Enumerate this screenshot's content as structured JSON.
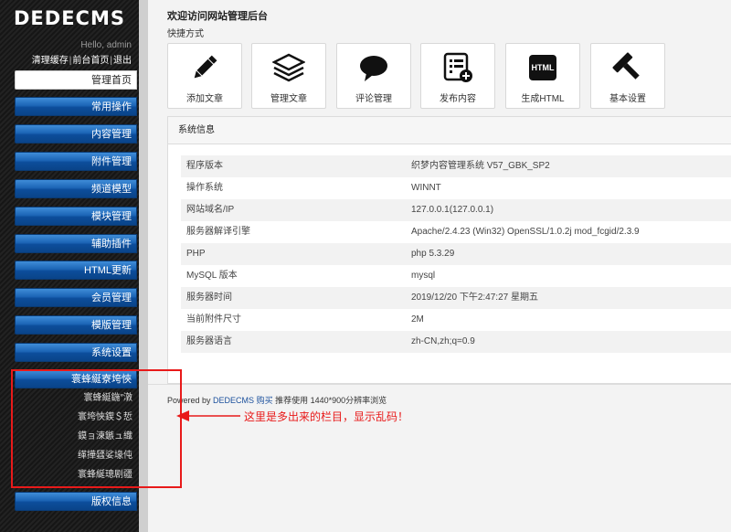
{
  "sidebar": {
    "logo": "DEDECMS",
    "hello": "Hello, admin",
    "links": [
      "清理缓存",
      "前台首页",
      "退出"
    ],
    "menu": [
      {
        "label": "管理首页",
        "active": true
      },
      {
        "label": "常用操作"
      },
      {
        "label": "内容管理"
      },
      {
        "label": "附件管理"
      },
      {
        "label": "频道模型"
      },
      {
        "label": "模块管理"
      },
      {
        "label": "辅助插件"
      },
      {
        "label": "HTML更新"
      },
      {
        "label": "会员管理"
      },
      {
        "label": "模版管理"
      },
      {
        "label": "系统设置"
      },
      {
        "label": "寰蜂綖寮垮悏"
      }
    ],
    "garbled_subitems": [
      "寰蜂綖鍦″潡",
      "寰垮悏鍥＄悊",
      "鏌ョ湅鏃ュ織",
      "缂撶瓥娑堟伅",
      "寰蜂綖璁剧疆"
    ],
    "last_menu": "版权信息"
  },
  "main": {
    "welcome": "欢迎访问网站管理后台",
    "shortcuts_label": "快捷方式",
    "shortcuts": [
      {
        "label": "添加文章",
        "icon": "pencil-icon"
      },
      {
        "label": "管理文章",
        "icon": "stack-icon"
      },
      {
        "label": "评论管理",
        "icon": "comment-icon"
      },
      {
        "label": "发布内容",
        "icon": "publish-icon"
      },
      {
        "label": "生成HTML",
        "icon": "html-icon",
        "icon_text": "HTML"
      },
      {
        "label": "基本设置",
        "icon": "hammer-icon"
      }
    ],
    "sysinfo_title": "系统信息",
    "sysinfo": [
      {
        "k": "程序版本",
        "v": "织梦内容管理系统 V57_GBK_SP2"
      },
      {
        "k": "操作系统",
        "v": "WINNT"
      },
      {
        "k": "网站域名/IP",
        "v": "127.0.0.1(127.0.0.1)"
      },
      {
        "k": "服务器解译引擎",
        "v": "Apache/2.4.23 (Win32) OpenSSL/1.0.2j mod_fcgid/2.3.9"
      },
      {
        "k": "PHP",
        "v": "php 5.3.29"
      },
      {
        "k": "MySQL 版本",
        "v": "mysql"
      },
      {
        "k": "服务器时间",
        "v": "2019/12/20 下午2:47:27 星期五"
      },
      {
        "k": "当前附件尺寸",
        "v": "2M"
      },
      {
        "k": "服务器语言",
        "v": "zh-CN,zh;q=0.9"
      }
    ],
    "footer": {
      "prefix": "Powered by",
      "brand": "DEDECMS",
      "buy": "购买",
      "suffix": "推荐使用 1440*900分辨率浏览"
    }
  },
  "annotation": {
    "note": "这里是多出来的栏目，显示乱码！",
    "color": "#e81a1a"
  }
}
